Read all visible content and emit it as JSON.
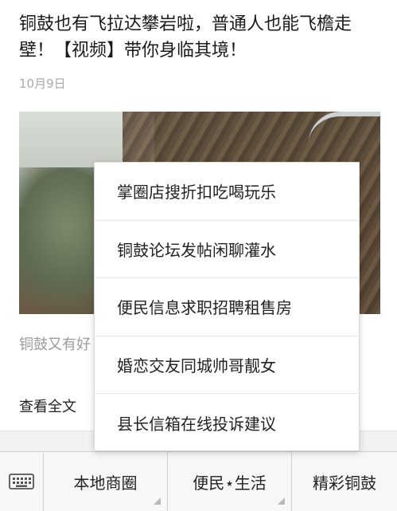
{
  "article": {
    "title": "铜鼓也有飞拉达攀岩啦，普通人也能飞檐走壁！【视频】带你身临其境！",
    "date": "10月9日",
    "excerpt": "铜鼓又有好",
    "read_more": "查看全文"
  },
  "popup_menu": {
    "items": [
      {
        "label": "掌圈店搜折扣吃喝玩乐"
      },
      {
        "label": "铜鼓论坛发帖闲聊灌水"
      },
      {
        "label": "便民信息求职招聘租售房"
      },
      {
        "label": "婚恋交友同城帅哥靓女"
      },
      {
        "label": "县长信箱在线投诉建议"
      }
    ]
  },
  "bottom_bar": {
    "keyboard_icon": "keyboard-icon",
    "tabs": [
      {
        "label": "本地商圈"
      },
      {
        "label": "便民⋆生活"
      },
      {
        "label": "精彩铜鼓"
      }
    ]
  }
}
